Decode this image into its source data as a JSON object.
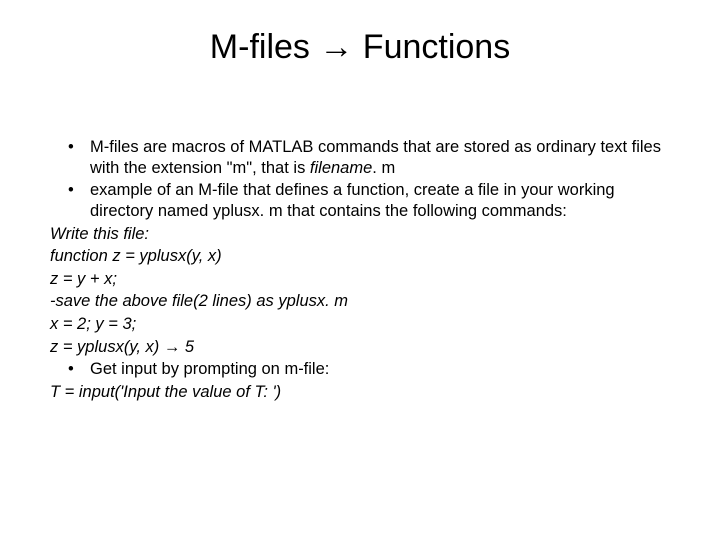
{
  "title": "M-files → Functions",
  "bullets": {
    "b1_pre": "M-files are macros of MATLAB commands that are stored as ordinary text files with the extension \"m\", that is ",
    "b1_fname": "filename",
    "b1_post": ". m",
    "b2": "example of an M-file that defines a function, create a file in your working directory named yplusx. m that contains the following commands:",
    "b3": "Get input by prompting on m-file:"
  },
  "lines": {
    "write": "Write this file:",
    "func": "function z = yplusx(y, x)",
    "assign": "z = y + x;",
    "save": "-save the above file(2 lines) as yplusx. m",
    "xy": "x = 2; y = 3;",
    "call_pre": "z = yplusx(y, x)  ",
    "call_arrow": "→",
    "call_post": " 5",
    "input": "T = input('Input the value of T: ')"
  }
}
